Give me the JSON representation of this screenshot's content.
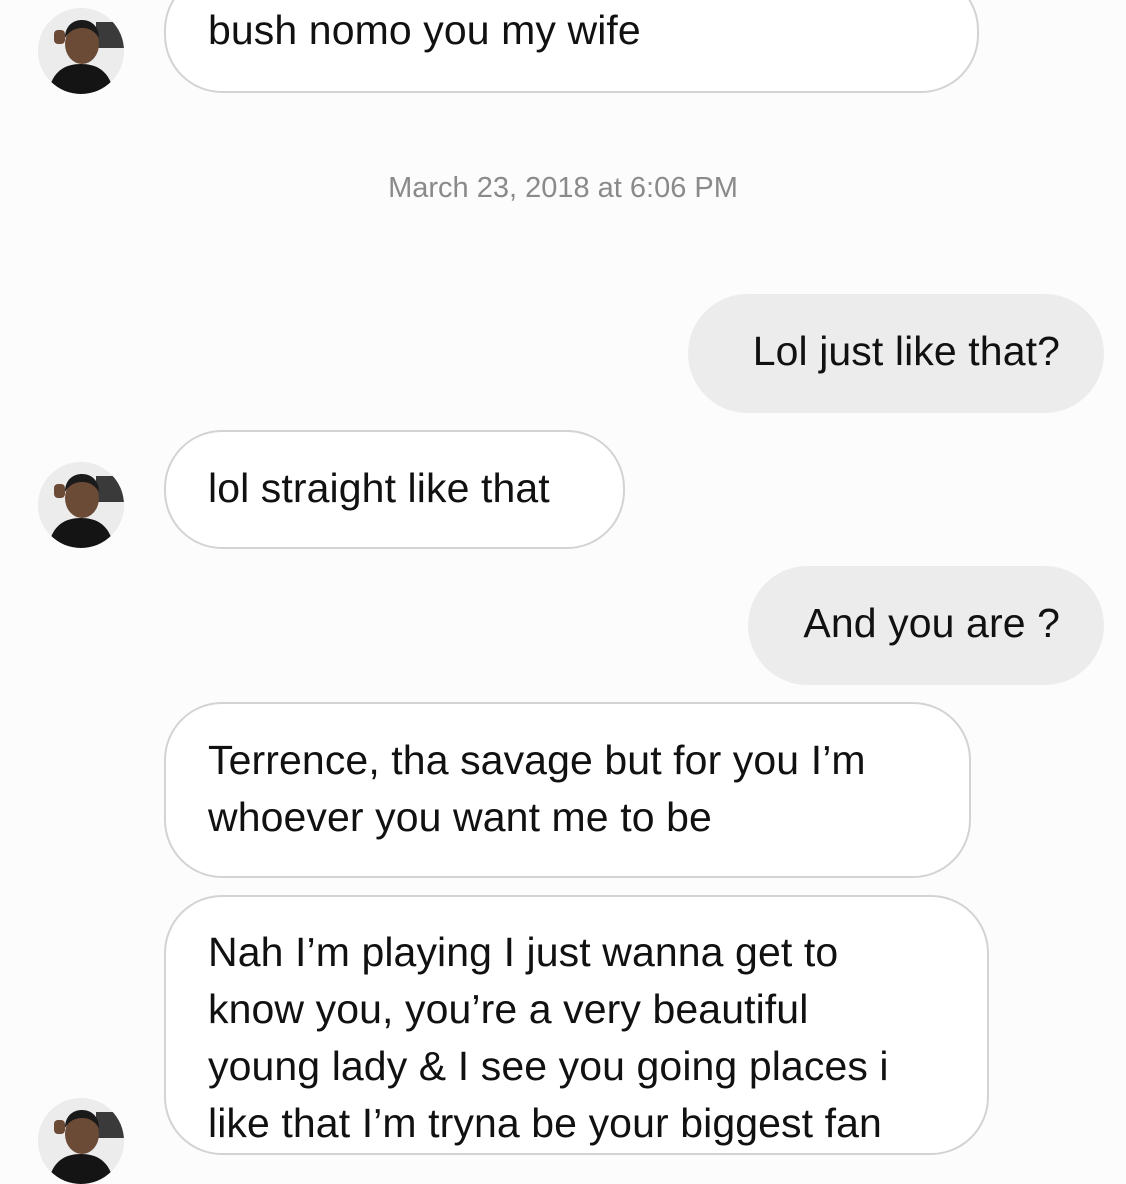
{
  "contact": {
    "avatar_icon": "profile-photo-icon"
  },
  "timestamp": "March 23, 2018 at 6:06 PM",
  "messages": [
    {
      "direction": "incoming",
      "lines": [
        "bush nomo you my wife"
      ]
    },
    {
      "direction": "outgoing",
      "lines": [
        "Lol just like that?"
      ]
    },
    {
      "direction": "incoming",
      "lines": [
        "lol straight like that"
      ]
    },
    {
      "direction": "outgoing",
      "lines": [
        "And you are ?"
      ]
    },
    {
      "direction": "incoming",
      "lines": [
        "Terrence, tha savage but for you I’m",
        "whoever you want me to be"
      ]
    },
    {
      "direction": "incoming",
      "lines": [
        "Nah I’m playing I just wanna get to",
        "know you, you’re a very beautiful",
        "young lady & I see you going places i",
        "like that I’m tryna be your biggest fan"
      ]
    }
  ],
  "colors": {
    "background": "#fdfcfd",
    "incoming_bubble": "#ffffff",
    "incoming_border": "#d3d3d3",
    "outgoing_bubble": "#ececec",
    "timestamp_text": "#8a8a8a"
  }
}
